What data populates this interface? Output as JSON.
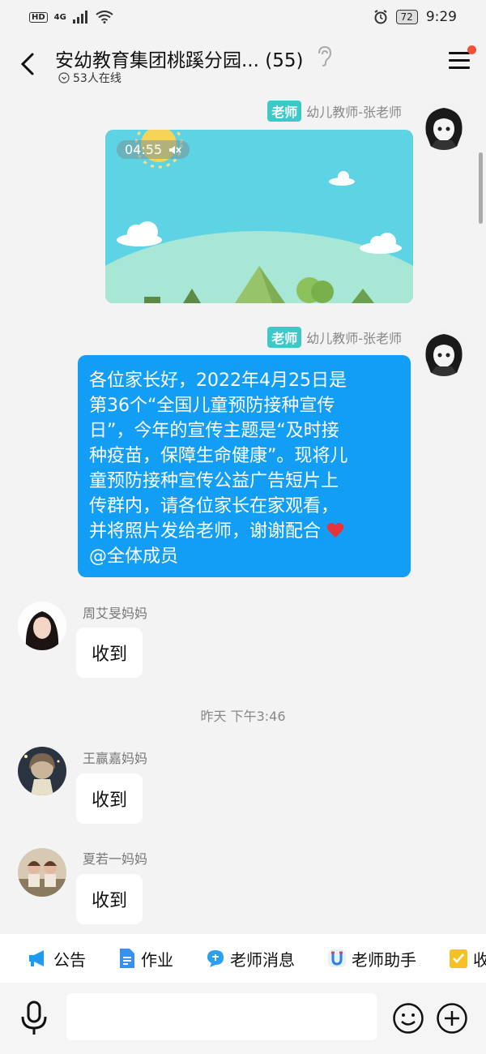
{
  "status_bar": {
    "left_badge": "HD",
    "network": "4G",
    "battery": "72",
    "time": "9:29"
  },
  "header": {
    "title": "安幼教育集团桃蹊分园... (55)",
    "online": "53人在线"
  },
  "messages": {
    "teacher_tag": "老师",
    "teacher_name": "幼儿教师-张老师",
    "video_duration": "04:55",
    "announcement_lines": [
      "各位家长好，2022年4月25日是",
      "第36个“全国儿童预防接种宣传",
      "日”，今年的宣传主题是“及时接",
      "种疫苗，保障生命健康”。现将儿",
      "童预防接种宣传公益广告短片上",
      "传群内，请各位家长在家观看，",
      "并将照片发给老师，谢谢配合",
      "@全体成员"
    ],
    "reply1_name": "周艾旻妈妈",
    "reply1_text": "收到",
    "timestamp": "昨天 下午3:46",
    "reply2_name": "王赢嘉妈妈",
    "reply2_text": "收到",
    "reply3_name": "夏若一妈妈",
    "reply3_text": "收到"
  },
  "toolbar": {
    "items": [
      "公告",
      "作业",
      "老师消息",
      "老师助手",
      "收"
    ]
  },
  "input": {
    "placeholder": ""
  },
  "colors": {
    "bubble_blue": "#139ef6",
    "teacher_tag": "#3ec9c9",
    "badge_red": "#f2503a"
  }
}
